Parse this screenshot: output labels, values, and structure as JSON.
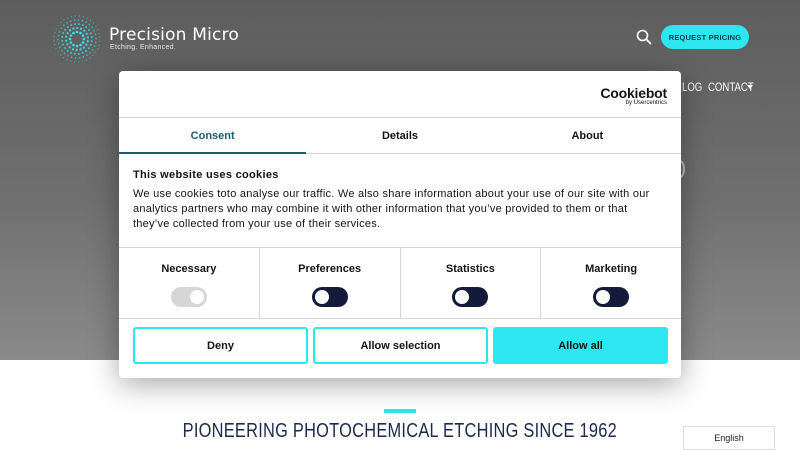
{
  "header": {
    "brand_name": "Precision Micro",
    "brand_tagline": "Etching. Enhanced.",
    "request_pricing_label": "REQUEST PRICING",
    "nav": {
      "partial_item": "LOG",
      "contact": "CONTACT"
    }
  },
  "page": {
    "headline": "PIONEERING PHOTOCHEMICAL ETCHING SINCE 1962",
    "language": "English"
  },
  "cookie_dialog": {
    "provider": {
      "name": "Cookiebot",
      "by": "by Usercentrics"
    },
    "tabs": [
      {
        "label": "Consent",
        "active": true
      },
      {
        "label": "Details",
        "active": false
      },
      {
        "label": "About",
        "active": false
      }
    ],
    "heading": "This website uses cookies",
    "body": "We use cookies toto analyse our traffic. We also share information about your use of our site with our analytics partners who may combine it with other information that you’ve provided to them or that they’ve collected from your use of their services.",
    "categories": [
      {
        "label": "Necessary",
        "state": "on-locked"
      },
      {
        "label": "Preferences",
        "state": "off"
      },
      {
        "label": "Statistics",
        "state": "off"
      },
      {
        "label": "Marketing",
        "state": "off"
      }
    ],
    "buttons": {
      "deny": "Deny",
      "allow_selection": "Allow selection",
      "allow_all": "Allow all"
    }
  },
  "colors": {
    "accent": "#2ee6f0",
    "navy": "#141a3a",
    "teal_tab": "#1b5f6c",
    "hero_gray": "#666666"
  },
  "icons": {
    "logo": "radial-burst-logo-icon",
    "search": "search-icon",
    "caret": "caret-down-icon"
  }
}
